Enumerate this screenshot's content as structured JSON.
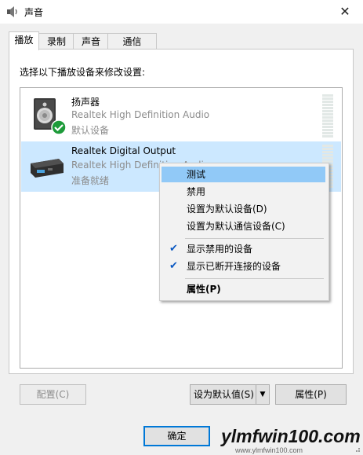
{
  "window": {
    "title": "声音",
    "close_glyph": "✕"
  },
  "tabs": [
    {
      "label": "播放",
      "active": true
    },
    {
      "label": "录制",
      "active": false
    },
    {
      "label": "声音",
      "active": false
    },
    {
      "label": "通信",
      "active": false
    }
  ],
  "instruction": "选择以下播放设备来修改设置:",
  "devices": [
    {
      "name": "扬声器",
      "driver": "Realtek High Definition Audio",
      "status": "默认设备",
      "icon": "speaker-icon",
      "default_badge": "check-badge-icon",
      "selected": false
    },
    {
      "name": "Realtek Digital Output",
      "driver": "Realtek High Definition Audio",
      "status": "准备就绪",
      "icon": "digital-output-icon",
      "selected": true
    }
  ],
  "context_menu": {
    "items": [
      {
        "label": "测试",
        "checked": false,
        "hover": true,
        "bold": false
      },
      {
        "label": "禁用",
        "checked": false,
        "hover": false,
        "bold": false
      },
      {
        "label": "设置为默认设备(D)",
        "checked": false,
        "hover": false,
        "bold": false
      },
      {
        "label": "设置为默认通信设备(C)",
        "checked": false,
        "hover": false,
        "bold": false
      },
      {
        "label": "显示禁用的设备",
        "checked": true,
        "hover": false,
        "bold": false
      },
      {
        "label": "显示已断开连接的设备",
        "checked": true,
        "hover": false,
        "bold": false
      },
      {
        "label": "属性(P)",
        "checked": false,
        "hover": false,
        "bold": true
      }
    ],
    "check_glyph": "✔"
  },
  "buttons": {
    "configure": "配置(C)",
    "set_default": "设为默认值(S)",
    "set_default_arrow": "▼",
    "properties": "属性(P)",
    "ok": "确定"
  },
  "watermark": {
    "text": "ylmfwin100.com",
    "sub": "www.ylmfwin100.com"
  },
  "colors": {
    "selection": "#cce8ff",
    "menu_hover": "#91c9f7",
    "accent": "#0078d7",
    "check_green": "#1e9b3a"
  }
}
